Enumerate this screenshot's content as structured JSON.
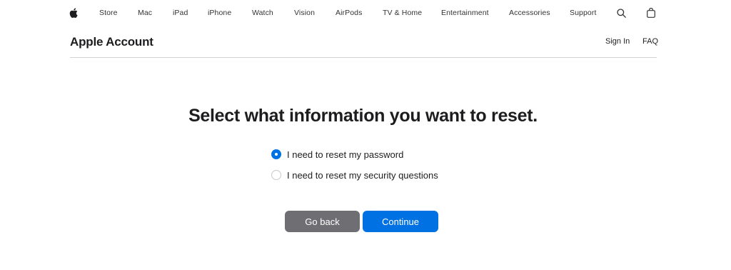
{
  "globalnav": {
    "items": [
      {
        "label": "Store"
      },
      {
        "label": "Mac"
      },
      {
        "label": "iPad"
      },
      {
        "label": "iPhone"
      },
      {
        "label": "Watch"
      },
      {
        "label": "Vision"
      },
      {
        "label": "AirPods"
      },
      {
        "label": "TV & Home"
      },
      {
        "label": "Entertainment"
      },
      {
        "label": "Accessories"
      },
      {
        "label": "Support"
      }
    ],
    "icons": [
      "apple-logo",
      "search-icon",
      "bag-icon"
    ]
  },
  "localnav": {
    "title": "Apple Account",
    "sign_in": "Sign In",
    "faq": "FAQ"
  },
  "main": {
    "heading": "Select what information you want to reset.",
    "options": [
      {
        "label": "I need to reset my password",
        "selected": true
      },
      {
        "label": "I need to reset my security questions",
        "selected": false
      }
    ],
    "go_back_label": "Go back",
    "continue_label": "Continue"
  },
  "colors": {
    "accent": "#0071e3",
    "secondary_button": "#6e6e73",
    "text": "#1d1d1f"
  }
}
